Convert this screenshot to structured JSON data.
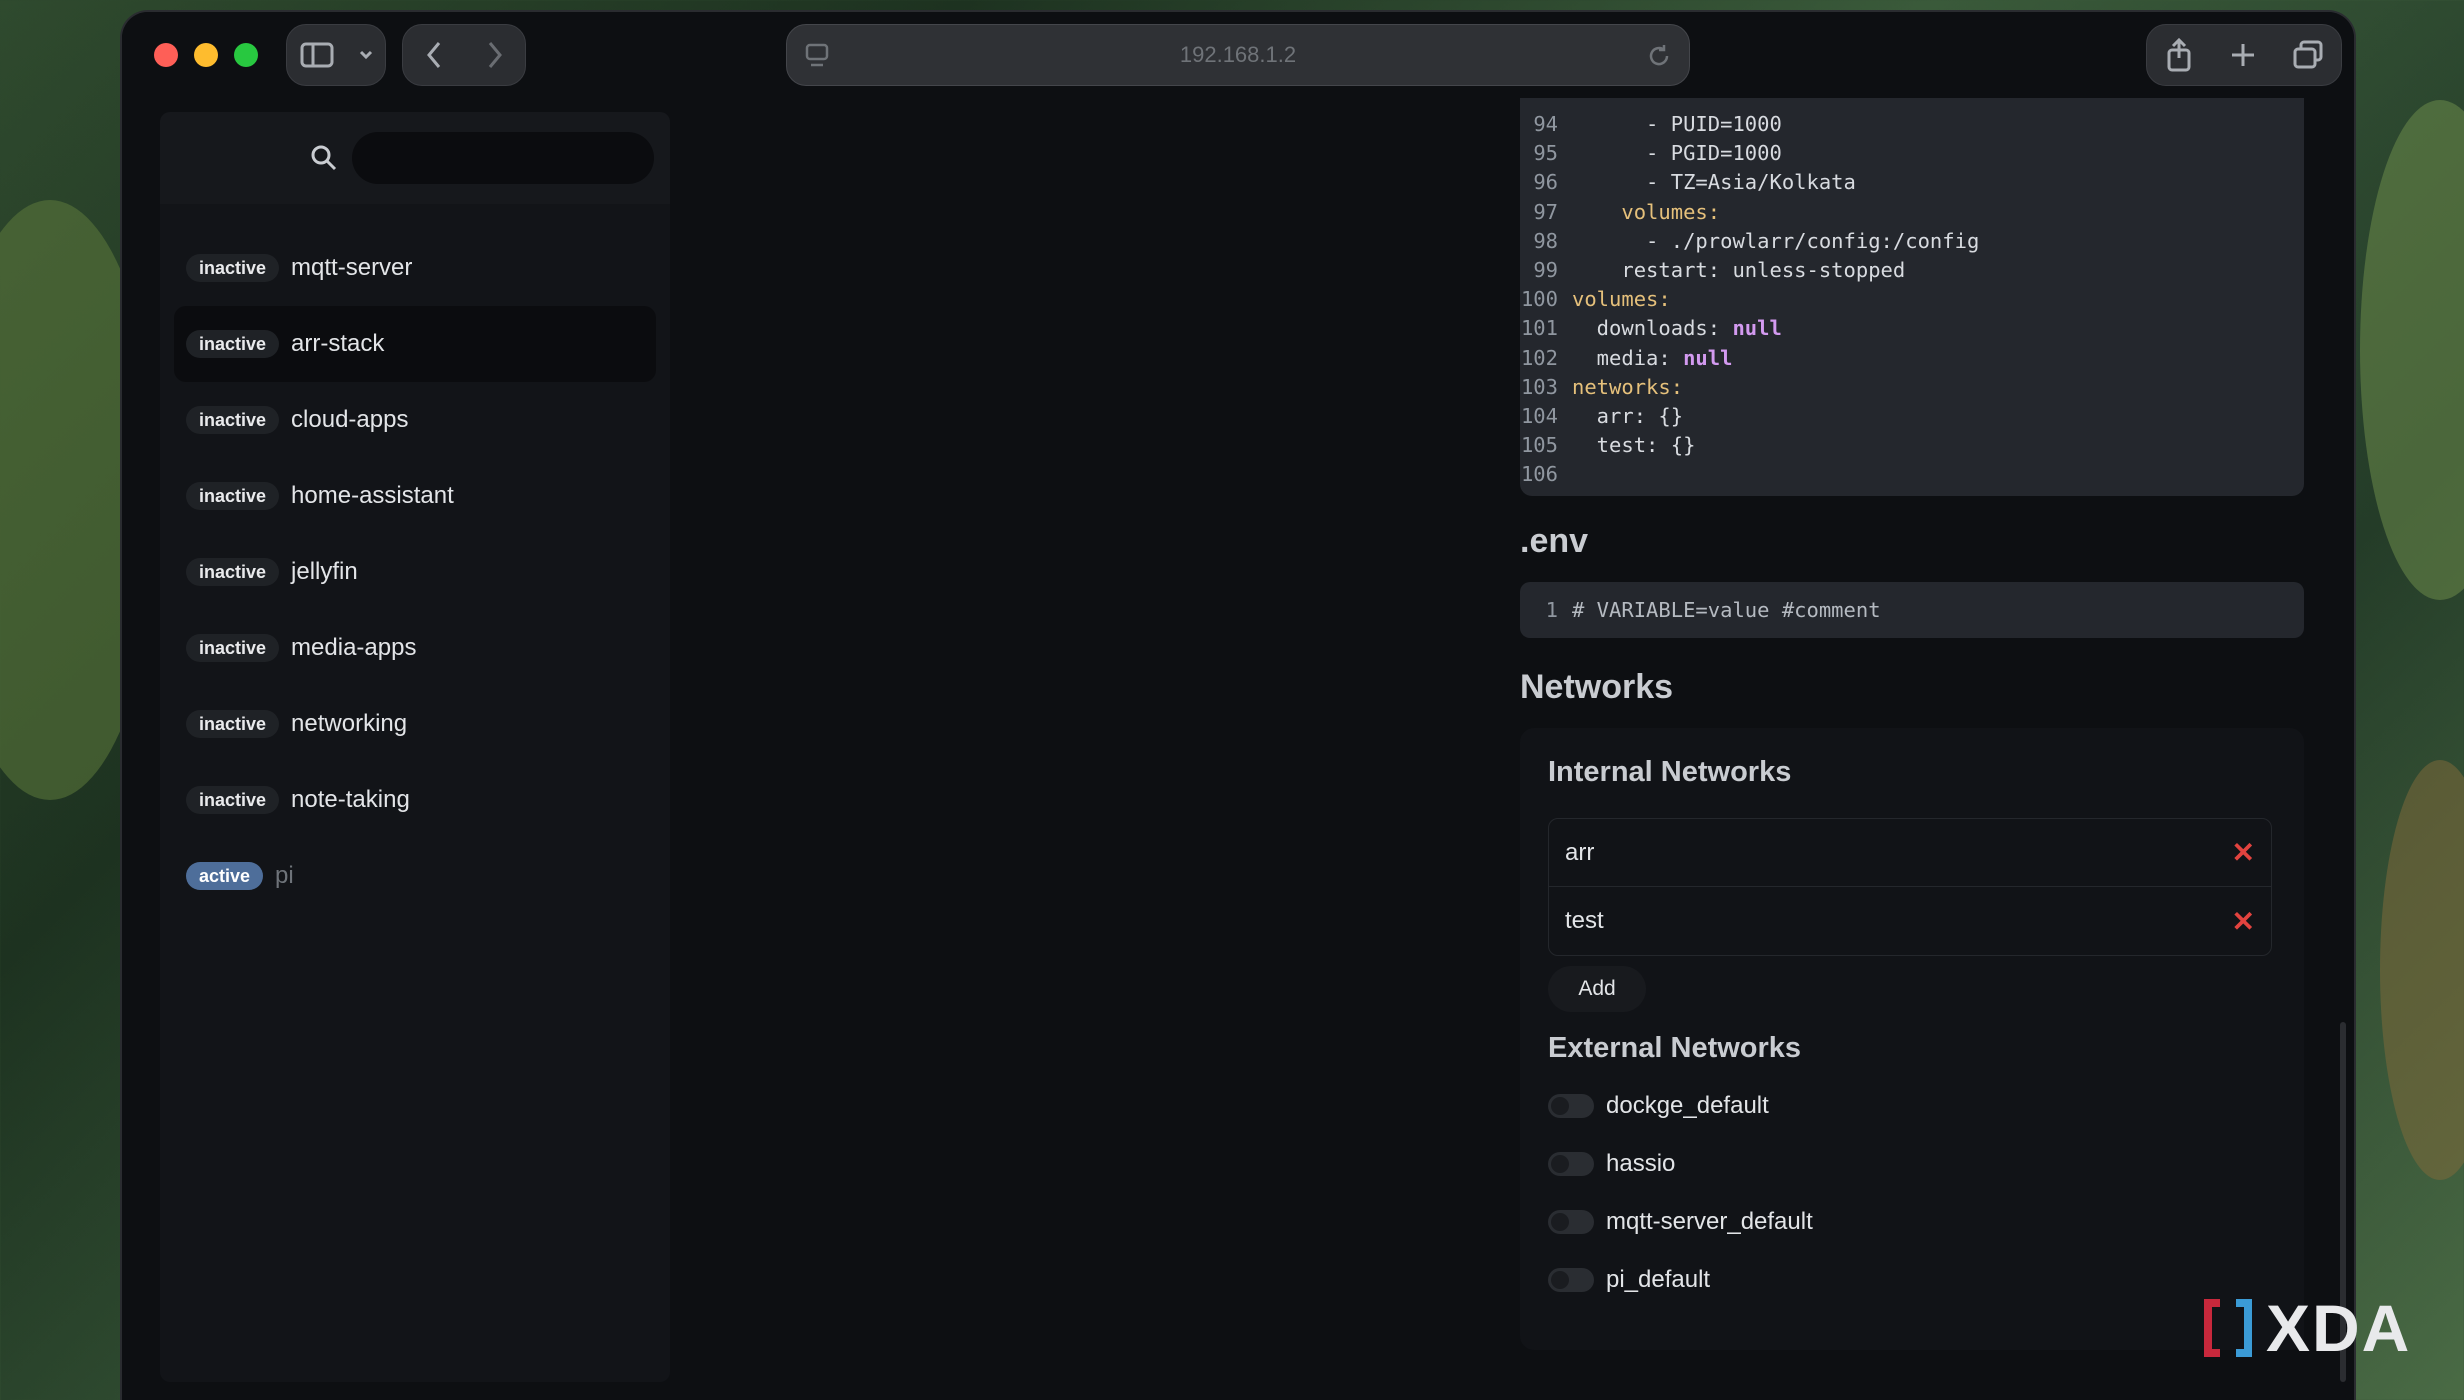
{
  "browser": {
    "url": "192.168.1.2"
  },
  "sidebar": {
    "search_placeholder": "",
    "stacks": [
      {
        "status": "inactive",
        "name": "mqtt-server"
      },
      {
        "status": "inactive",
        "name": "arr-stack"
      },
      {
        "status": "inactive",
        "name": "cloud-apps"
      },
      {
        "status": "inactive",
        "name": "home-assistant"
      },
      {
        "status": "inactive",
        "name": "jellyfin"
      },
      {
        "status": "inactive",
        "name": "media-apps"
      },
      {
        "status": "inactive",
        "name": "networking"
      },
      {
        "status": "inactive",
        "name": "note-taking"
      },
      {
        "status": "active",
        "name": "pi"
      }
    ]
  },
  "compose": {
    "lines": [
      {
        "n": "94",
        "text": "      - PUID=1000"
      },
      {
        "n": "95",
        "text": "      - PGID=1000"
      },
      {
        "n": "96",
        "text": "      - TZ=Asia/Kolkata"
      },
      {
        "n": "97",
        "text": "    volumes:"
      },
      {
        "n": "98",
        "text": "      - ./prowlarr/config:/config"
      },
      {
        "n": "99",
        "text": "    restart: unless-stopped"
      },
      {
        "n": "100",
        "text": "volumes:"
      },
      {
        "n": "101",
        "text": "  downloads: ",
        "kw": "null"
      },
      {
        "n": "102",
        "text": "  media: ",
        "kw": "null"
      },
      {
        "n": "103",
        "text": "networks:"
      },
      {
        "n": "104",
        "text": "  arr: {}"
      },
      {
        "n": "105",
        "text": "  test: {}"
      },
      {
        "n": "106",
        "text": ""
      }
    ]
  },
  "env": {
    "title": ".env",
    "line_number": "1",
    "line_text": "# VARIABLE=value #comment"
  },
  "networks": {
    "title": "Networks",
    "internal_title": "Internal Networks",
    "internal": [
      "arr",
      "test"
    ],
    "add_label": "Add",
    "external_title": "External Networks",
    "external": [
      "dockge_default",
      "hassio",
      "mqtt-server_default",
      "pi_default"
    ]
  },
  "watermark": "XDA",
  "colors": {
    "active_badge": "#4e6e9a",
    "delete": "#e2433f",
    "null_keyword": "#d39af0"
  }
}
